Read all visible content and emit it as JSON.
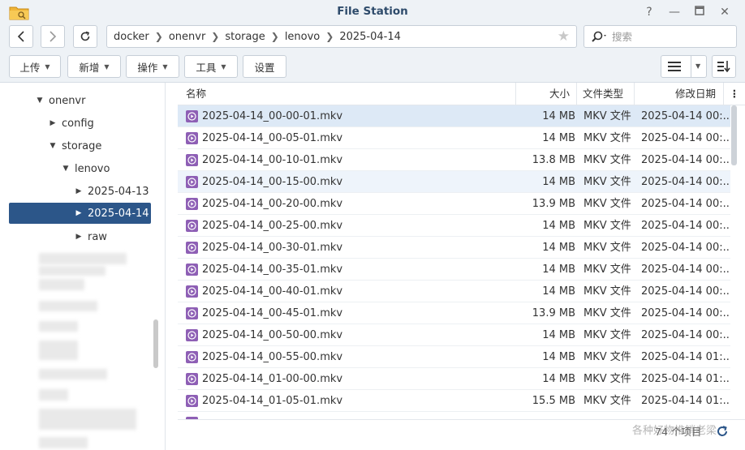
{
  "window": {
    "title": "File Station",
    "controls": [
      "help-icon",
      "minimize-icon",
      "maximize-icon",
      "close-icon"
    ]
  },
  "nav": {
    "breadcrumbs": [
      "docker",
      "onenvr",
      "storage",
      "lenovo",
      "2025-04-14"
    ],
    "search_placeholder": "搜索"
  },
  "toolbar": {
    "upload": "上传",
    "create": "新增",
    "action": "操作",
    "tools": "工具",
    "settings": "设置"
  },
  "sidebar": {
    "items": [
      {
        "label": "onenvr",
        "expanded": true
      },
      {
        "label": "config",
        "expanded": false
      },
      {
        "label": "storage",
        "expanded": true
      },
      {
        "label": "lenovo",
        "expanded": true
      },
      {
        "label": "2025-04-13",
        "expanded": false
      },
      {
        "label": "2025-04-14",
        "expanded": false,
        "selected": true
      },
      {
        "label": "raw",
        "expanded": false
      }
    ]
  },
  "list": {
    "columns": {
      "name": "名称",
      "size": "大小",
      "type": "文件类型",
      "modified": "修改日期"
    },
    "rows": [
      {
        "name": "2025-04-14_00-00-01.mkv",
        "size": "14 MB",
        "type": "MKV 文件",
        "modified": "2025-04-14 00:..."
      },
      {
        "name": "2025-04-14_00-05-01.mkv",
        "size": "14 MB",
        "type": "MKV 文件",
        "modified": "2025-04-14 00:..."
      },
      {
        "name": "2025-04-14_00-10-01.mkv",
        "size": "13.8 MB",
        "type": "MKV 文件",
        "modified": "2025-04-14 00:..."
      },
      {
        "name": "2025-04-14_00-15-00.mkv",
        "size": "14 MB",
        "type": "MKV 文件",
        "modified": "2025-04-14 00:..."
      },
      {
        "name": "2025-04-14_00-20-00.mkv",
        "size": "13.9 MB",
        "type": "MKV 文件",
        "modified": "2025-04-14 00:..."
      },
      {
        "name": "2025-04-14_00-25-00.mkv",
        "size": "14 MB",
        "type": "MKV 文件",
        "modified": "2025-04-14 00:..."
      },
      {
        "name": "2025-04-14_00-30-01.mkv",
        "size": "14 MB",
        "type": "MKV 文件",
        "modified": "2025-04-14 00:..."
      },
      {
        "name": "2025-04-14_00-35-01.mkv",
        "size": "14 MB",
        "type": "MKV 文件",
        "modified": "2025-04-14 00:..."
      },
      {
        "name": "2025-04-14_00-40-01.mkv",
        "size": "14 MB",
        "type": "MKV 文件",
        "modified": "2025-04-14 00:..."
      },
      {
        "name": "2025-04-14_00-45-01.mkv",
        "size": "13.9 MB",
        "type": "MKV 文件",
        "modified": "2025-04-14 00:..."
      },
      {
        "name": "2025-04-14_00-50-00.mkv",
        "size": "14 MB",
        "type": "MKV 文件",
        "modified": "2025-04-14 00:..."
      },
      {
        "name": "2025-04-14_00-55-00.mkv",
        "size": "14 MB",
        "type": "MKV 文件",
        "modified": "2025-04-14 01:..."
      },
      {
        "name": "2025-04-14_01-00-00.mkv",
        "size": "14 MB",
        "type": "MKV 文件",
        "modified": "2025-04-14 01:..."
      },
      {
        "name": "2025-04-14_01-05-01.mkv",
        "size": "15.5 MB",
        "type": "MKV 文件",
        "modified": "2025-04-14 01:..."
      }
    ]
  },
  "status": {
    "count_text": "74 个项目",
    "watermark": "各种好物推销老梁"
  },
  "colors": {
    "selected_sidebar": "#2c5689",
    "file_icon": "#8e5fb5",
    "selected_row": "#dde9f6"
  }
}
